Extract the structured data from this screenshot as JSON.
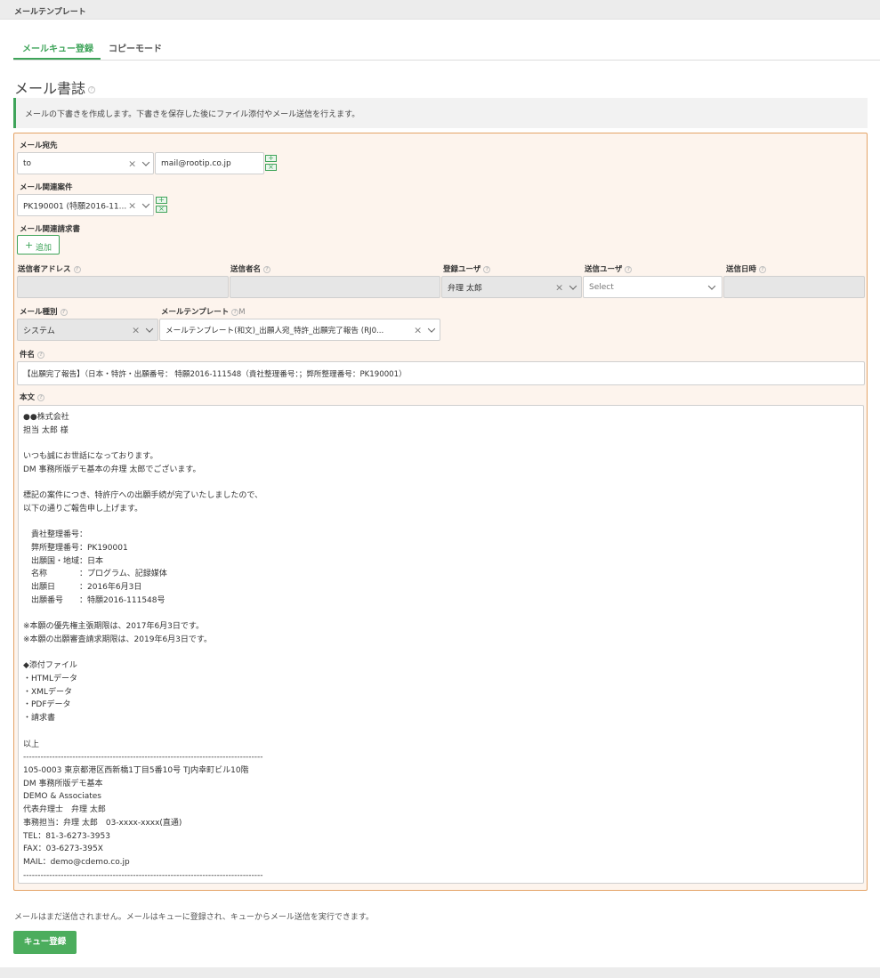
{
  "window": {
    "title": "メールテンプレート"
  },
  "tabs": [
    {
      "label": "メールキュー登録",
      "active": true
    },
    {
      "label": "コピーモード",
      "active": false
    }
  ],
  "section": {
    "title": "メール書誌",
    "help": "?"
  },
  "info_text": "メールの下書きを作成します。下書きを保存した後にファイル添付やメール送信を行えます。",
  "form": {
    "recipient": {
      "label": "メール宛先",
      "type_value": "to",
      "address_value": "mail@rootip.co.jp"
    },
    "related_case": {
      "label": "メール関連案件",
      "value": "PK190001 (特願2016-11..."
    },
    "related_invoice": {
      "label": "メール関連請求書",
      "add_label": "追加"
    },
    "sender_address": {
      "label": "送信者アドレス",
      "value": ""
    },
    "sender_name": {
      "label": "送信者名",
      "value": ""
    },
    "registered_user": {
      "label": "登録ユーザ",
      "value": "弁理 太郎"
    },
    "send_user": {
      "label": "送信ユーザ",
      "placeholder": "Select"
    },
    "send_datetime": {
      "label": "送信日時",
      "value": ""
    },
    "mail_type": {
      "label": "メール種別",
      "value": "システム"
    },
    "mail_template": {
      "label": "メールテンプレート",
      "suffix": "M",
      "value": "メールテンプレート(和文)_出願人宛_特許_出願完了報告 (RJ0..."
    },
    "subject": {
      "label": "件名",
      "value": "【出願完了報告】（日本・特許・出願番号： 特願2016-111548（貴社整理番号：；弊所整理番号：PK190001）"
    },
    "body": {
      "label": "本文",
      "text": "●●株式会社\n担当 太郎 様\n\nいつも誠にお世話になっております。\nDM 事務所版デモ基本の弁理 太郎でございます。\n\n標記の案件につき、特許庁への出願手続が完了いたしましたので、\n以下の通りご報告申し上げます。\n\n　貴社整理番号：\n　弊所整理番号：PK190001\n　出願国・地域：日本\n　名称　　　　：プログラム、記録媒体\n　出願日　　　：2016年6月3日\n　出願番号　　：特願2016-111548号\n\n※本願の優先権主張期限は、2017年6月3日です。\n※本願の出願審査請求期限は、2019年6月3日です。\n\n◆添付ファイル\n・HTMLデータ\n・XMLデータ\n・PDFデータ\n・請求書\n\n以上\n-----------------------------------------------------------------------------------\n105-0003 東京都港区西新橋1丁目5番10号 TJ内幸町ビル10階\nDM 事務所版デモ基本\nDEMO & Associates\n代表弁理士　弁理 太郎\n事務担当：弁理 太郎　03-xxxx-xxxx(直通)\nTEL：81-3-6273-3953\nFAX：03-6273-395X\nMAIL：demo@cdemo.co.jp\n-----------------------------------------------------------------------------------"
    }
  },
  "footer_note": "メールはまだ送信されません。メールはキューに登録され、キューからメール送信を実行できます。",
  "submit_label": "キュー登録",
  "icons": {
    "clear": "×",
    "plus": "+",
    "help": "?"
  },
  "colors": {
    "accent": "#3fa45a",
    "panel_bg": "#fdf4ed",
    "panel_border": "#e4a366"
  }
}
